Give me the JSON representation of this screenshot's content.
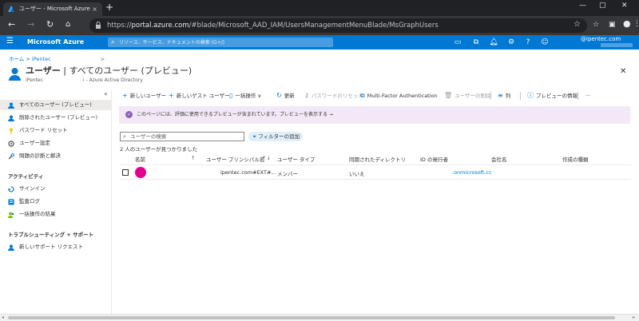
{
  "browser": {
    "tab_title": "ユーザー - Microsoft Azure",
    "tab_close": "×",
    "new_tab": "+",
    "url_prefix": "https://",
    "url_host": "portal.azure.com",
    "url_path": "/#blade/Microsoft_AAD_IAM/UsersManagementMenuBlade/MsGraphUsers",
    "window_controls": [
      "—",
      "▢",
      "✕"
    ]
  },
  "portal": {
    "brand": "Microsoft Azure",
    "search_placeholder": "リソース、サービス、ドキュメントの検索 (G+/)",
    "account": "@ipentec.com"
  },
  "breadcrumb": {
    "home": "ホーム",
    "sep": ">",
    "tenant": "iPentec",
    "sep2": ">"
  },
  "page": {
    "title_bold": "ユーザー",
    "title_rest": " | すべてのユーザー (プレビュー)",
    "subtitle_left": "iPentec",
    "subtitle_right": "i - Azure Active Directory",
    "close": "✕"
  },
  "leftnav": {
    "collapse": "«",
    "items": [
      {
        "label": "すべてのユーザー (プレビュー)"
      },
      {
        "label": "削除されたユーザー (プレビュー)"
      },
      {
        "label": "パスワード リセット"
      },
      {
        "label": "ユーザー設定"
      },
      {
        "label": "問題の診断と解決"
      }
    ],
    "section_activity": "アクティビティ",
    "activity_items": [
      {
        "label": "サインイン"
      },
      {
        "label": "監査ログ"
      },
      {
        "label": "一括操作の結果"
      }
    ],
    "section_support": "トラブルシューティング + サポート",
    "support_items": [
      {
        "label": "新しいサポート リクエスト"
      }
    ]
  },
  "commands": {
    "new_user": "新しいユーザー",
    "new_guest": "新しいゲスト ユーザー",
    "bulk": "一括操作",
    "bulk_chevron": "∨",
    "refresh": "更新",
    "reset_password": "パスワードのリセット",
    "mfa": "Multi-Factor Authentication",
    "delete_user": "ユーザーの削除",
    "columns": "列",
    "preview_info": "プレビューの情報",
    "more": "···"
  },
  "banner": {
    "text": "このページには、評価に使用できるプレビューが含まれています。プレビューを表示する →",
    "icon": "✓"
  },
  "filter": {
    "placeholder": "ユーザーの検索",
    "add_filter": "フィルターの追加"
  },
  "results_count": "2 人のユーザーが見つかりました",
  "table": {
    "headers": [
      "名前",
      "ユーザー プリンシパル名",
      "ユーザー タイプ",
      "同期されたディレクトリ",
      "ID の発行者",
      "会社名",
      "作成の種類"
    ],
    "rows": [
      {
        "name": "",
        "upn": "ipentec.com#EXT#...",
        "user_type": "メンバー",
        "synced": "いいえ",
        "issuer": ".onmicrosoft.cc",
        "company": "",
        "creation_type": ""
      }
    ]
  },
  "colors": {
    "azure_blue": "#0078d4",
    "avatar": "#e3008c",
    "banner_bg": "#f3e9f6"
  }
}
